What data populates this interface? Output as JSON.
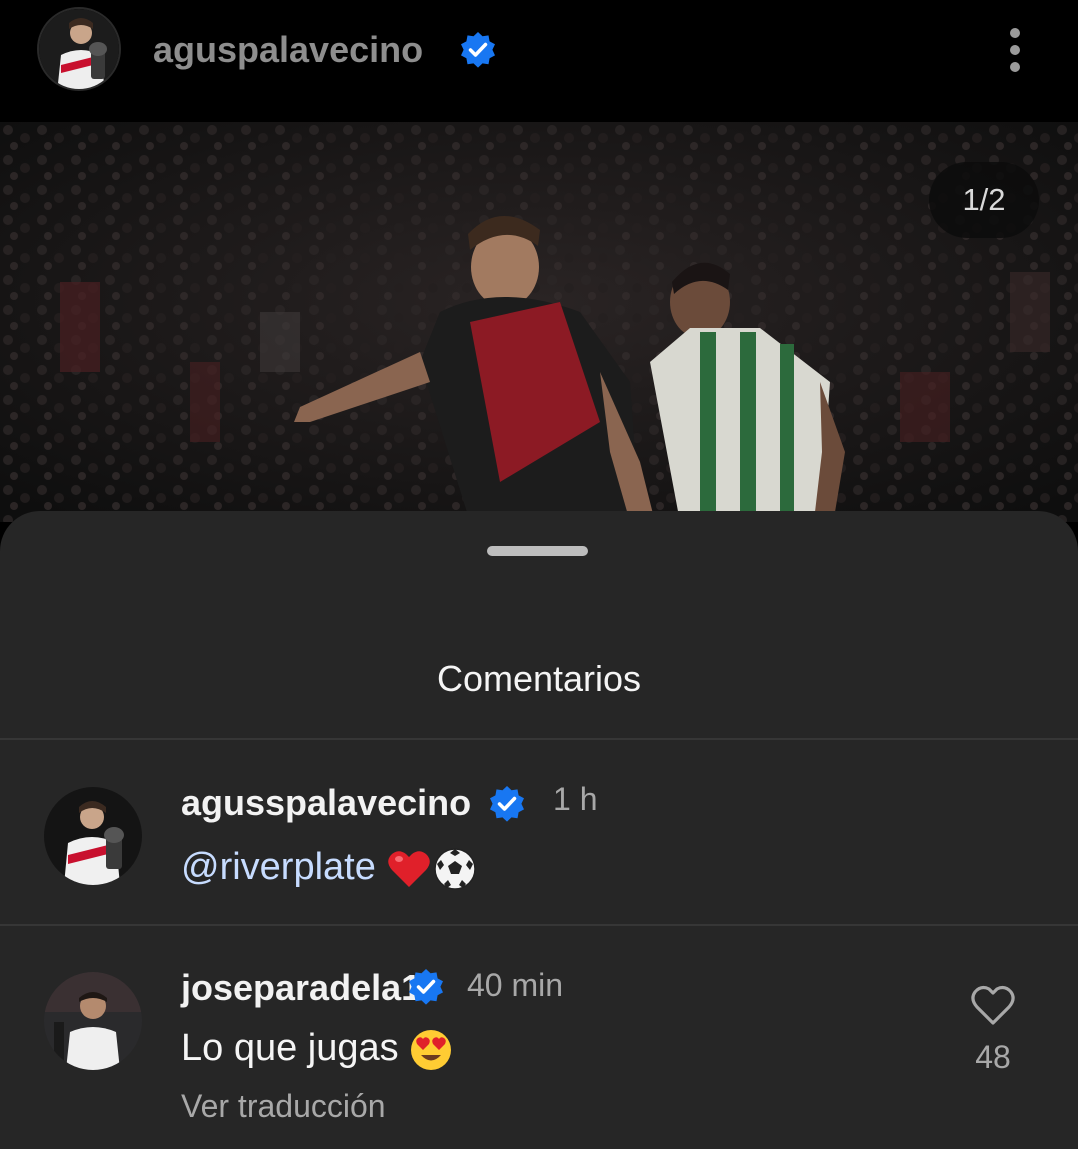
{
  "header": {
    "username": "aguspalavecino",
    "verified": true,
    "more_icon": "more-vertical-icon"
  },
  "post": {
    "photo_counter": "1/2"
  },
  "comments_sheet": {
    "title": "Comentarios",
    "comments": [
      {
        "username": "agusspalavecino",
        "verified": true,
        "time": "1 h",
        "mention": "@riverplate",
        "emojis": [
          "heart-emoji",
          "soccer-ball-emoji"
        ]
      },
      {
        "username": "joseparadela1",
        "verified": true,
        "time": "40 min",
        "text": "Lo que jugas",
        "emojis": [
          "heart-eyes-emoji"
        ],
        "translate_label": "Ver traducción",
        "likes": "48"
      }
    ]
  },
  "colors": {
    "verified_blue": "#1877f2",
    "sheet_background": "#262626",
    "header_background": "#000000"
  }
}
